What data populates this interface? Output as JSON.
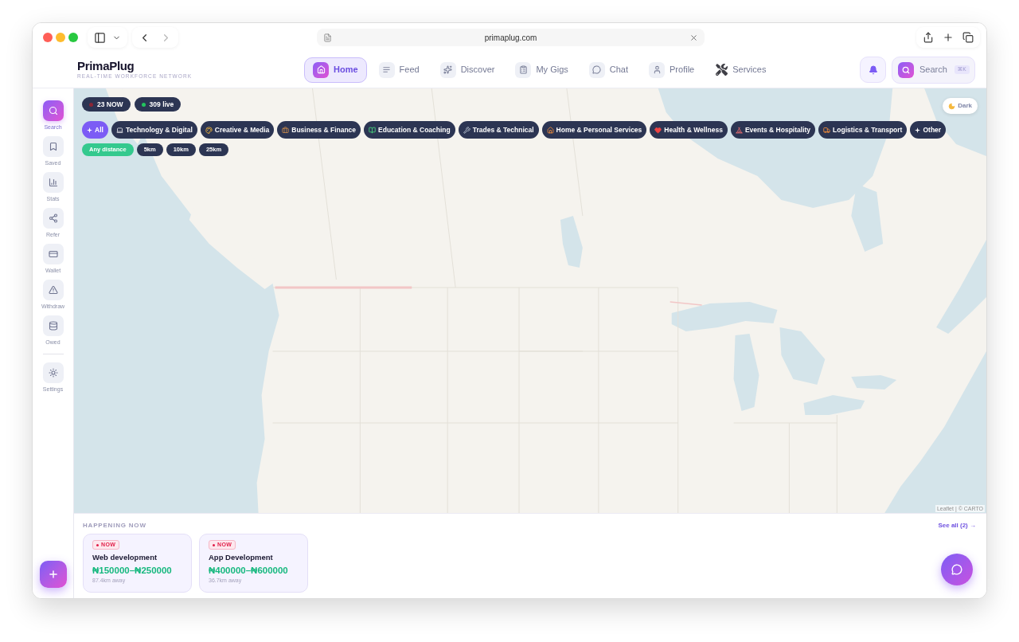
{
  "browser": {
    "url": "primaplug.com"
  },
  "header": {
    "brand": "PrimaPlug",
    "tagline": "REAL-TIME WORKFORCE NETWORK",
    "nav": [
      {
        "label": "Home",
        "selected": true
      },
      {
        "label": "Feed",
        "selected": false
      },
      {
        "label": "Discover",
        "selected": false
      },
      {
        "label": "My Gigs",
        "selected": false
      },
      {
        "label": "Chat",
        "selected": false
      },
      {
        "label": "Profile",
        "selected": false
      },
      {
        "label": "Services",
        "selected": false
      }
    ],
    "search": {
      "label": "Search",
      "shortcut": "⌘K"
    }
  },
  "sidebar": {
    "items": [
      {
        "label": "Search",
        "selected": true
      },
      {
        "label": "Saved",
        "selected": false
      },
      {
        "label": "Stats",
        "selected": false
      },
      {
        "label": "Refer",
        "selected": false
      },
      {
        "label": "Wallet",
        "selected": false
      },
      {
        "label": "Withdraw",
        "selected": false
      },
      {
        "label": "Owed",
        "selected": false
      }
    ],
    "footer_items": [
      {
        "label": "Settings",
        "selected": false
      }
    ]
  },
  "map": {
    "stats": [
      {
        "label": "23 NOW",
        "color": "#8b2635"
      },
      {
        "label": "309 live",
        "color": "#22c55e"
      }
    ],
    "theme_toggle": "Dark",
    "categories": [
      {
        "label": "All",
        "selected": true
      },
      {
        "label": "Technology & Digital",
        "selected": false
      },
      {
        "label": "Creative & Media",
        "selected": false
      },
      {
        "label": "Business & Finance",
        "selected": false
      },
      {
        "label": "Education & Coaching",
        "selected": false
      },
      {
        "label": "Trades & Technical",
        "selected": false
      },
      {
        "label": "Home & Personal Services",
        "selected": false
      },
      {
        "label": "Health & Wellness",
        "selected": false
      },
      {
        "label": "Events & Hospitality",
        "selected": false
      },
      {
        "label": "Logistics & Transport",
        "selected": false
      },
      {
        "label": "Other",
        "selected": false
      }
    ],
    "distances": [
      {
        "label": "Any distance",
        "selected": true
      },
      {
        "label": "5km",
        "selected": false
      },
      {
        "label": "10km",
        "selected": false
      },
      {
        "label": "25km",
        "selected": false
      }
    ],
    "attribution": "Leaflet | © CARTO"
  },
  "happening_now": {
    "title": "HAPPENING NOW",
    "see_all": "See all (2) →",
    "items": [
      {
        "badge": "NOW",
        "title": "Web development",
        "price": "₦150000–₦250000",
        "distance": "87.4km away"
      },
      {
        "badge": "NOW",
        "title": "App Development",
        "price": "₦400000–₦600000",
        "distance": "36.7km away"
      }
    ]
  }
}
